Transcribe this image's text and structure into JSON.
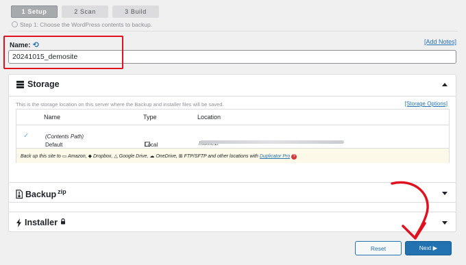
{
  "steps": [
    {
      "label": "1 Setup",
      "active": true
    },
    {
      "label": "2 Scan",
      "active": false
    },
    {
      "label": "3 Build",
      "active": false
    }
  ],
  "step_description": "Step 1: Choose the WordPress contents to backup.",
  "name": {
    "label": "Name:",
    "value": "20241015_demosite",
    "add_notes": "[Add Notes]"
  },
  "storage": {
    "title": "Storage",
    "description": "This is the storage location on this server where the Backup and installer files will be saved.",
    "options_link": "[Storage Options]",
    "columns": [
      "Name",
      "Type",
      "Location"
    ],
    "row": {
      "name": "Default",
      "name_suffix": "(Contents Path)",
      "type": "Local",
      "location_prefix": "/home1/"
    },
    "footer": {
      "prefix": "Back up this site to",
      "amazon": "Amazon,",
      "dropbox": "Dropbox,",
      "gdrive": "Google Drive,",
      "onedrive": "OneDrive,",
      "ftp": "FTP/SFTP and other locations with",
      "link": "Duplicator Pro",
      "q": "?"
    }
  },
  "backup": {
    "title": "Backup",
    "sup": "zip"
  },
  "installer": {
    "title": "Installer"
  },
  "buttons": {
    "reset": "Reset",
    "next": "Next ▶"
  },
  "colors": {
    "accent": "#2271b1",
    "highlight": "#e0101e"
  }
}
